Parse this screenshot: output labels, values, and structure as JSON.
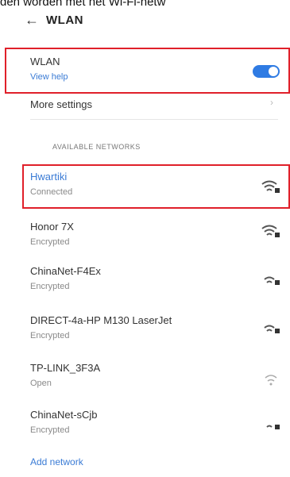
{
  "header": {
    "back_icon": "←",
    "title": "WLAN"
  },
  "wlan": {
    "title": "WLAN",
    "help_link": "View help",
    "enabled": true
  },
  "more_settings": {
    "label": "More settings",
    "chevron": "›"
  },
  "section": {
    "title": "AVAILABLE NETWORKS"
  },
  "networks": [
    {
      "name": "Hwartiki",
      "status": "Connected",
      "signal_icon": "wifi-locked-icon"
    },
    {
      "name": "Honor 7X",
      "status": "Encrypted",
      "signal_icon": "wifi-locked-icon"
    },
    {
      "name": "ChinaNet-F4Ex",
      "status": "Encrypted",
      "signal_icon": "wifi-locked-icon"
    },
    {
      "name": "DIRECT-4a-HP M130 LaserJet",
      "status": "Encrypted",
      "signal_icon": "wifi-locked-icon"
    },
    {
      "name": "TP-LINK_3F3A",
      "status": "Open",
      "signal_icon": "wifi-icon"
    },
    {
      "name": "ChinaNet-sCjb",
      "status": "Encrypted",
      "signal_icon": "wifi-locked-icon"
    }
  ],
  "add_network": {
    "label": "Add network"
  },
  "colors": {
    "accent": "#2f7be3",
    "highlight": "#e0202a"
  }
}
